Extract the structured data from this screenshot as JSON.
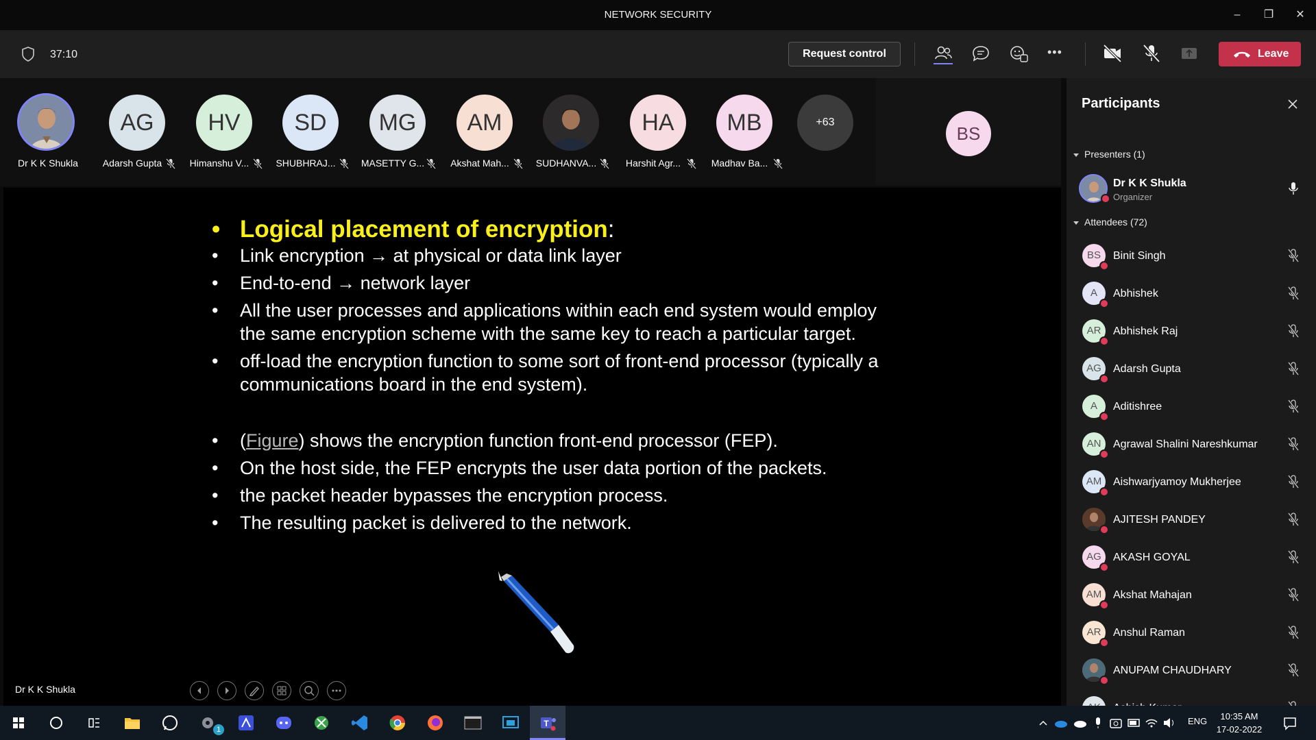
{
  "window": {
    "title": "NETWORK SECURITY",
    "minimize": "–",
    "restore": "❐",
    "close": "✕"
  },
  "toolbar": {
    "timer": "37:10",
    "request_control": "Request control",
    "leave": "Leave",
    "more": "•••"
  },
  "strip": {
    "participants": [
      {
        "initials": "",
        "name": "Dr K K Shukla",
        "color": "#7a8aa8"
      },
      {
        "initials": "AG",
        "name": "Adarsh Gupta",
        "color": "#d9e3ea"
      },
      {
        "initials": "HV",
        "name": "Himanshu V...",
        "color": "#d6efdb"
      },
      {
        "initials": "SD",
        "name": "SHUBHRAJ...",
        "color": "#dbe6f6"
      },
      {
        "initials": "MG",
        "name": "MASETTY G...",
        "color": "#dfe5ea"
      },
      {
        "initials": "AM",
        "name": "Akshat Mah...",
        "color": "#f8dfd4"
      },
      {
        "initials": "",
        "name": "SUDHANVA...",
        "color": "#3a3330"
      },
      {
        "initials": "HA",
        "name": "Harshit Agr...",
        "color": "#f7dde1"
      },
      {
        "initials": "MB",
        "name": "Madhav Ba...",
        "color": "#f6d9ec"
      }
    ],
    "overflow": "+63",
    "bs_initials": "BS"
  },
  "slide": {
    "heading": "Logical placement of encryption",
    "heading_colon": ":",
    "bullet_char": "•",
    "bullets_a": [
      "Link encryption → at physical or data link layer",
      "End-to-end → network layer",
      "All the user processes and applications within each end system would employ the same encryption scheme with the same key to reach a particular target.",
      "off-load the encryption function to some sort of front-end processor (typically a communications board in the end system)."
    ],
    "fig_open": "(",
    "fig_link": "Figure",
    "fig_rest": ") shows the encryption function front-end processor (FEP).",
    "bullets_b": [
      "On the host side, the FEP encrypts the user data portion of the packets.",
      "the packet header bypasses the encryption process.",
      "The resulting packet is delivered to the network."
    ]
  },
  "stage": {
    "speaker": "Dr K K Shukla"
  },
  "panel": {
    "title": "Participants",
    "presenters_label": "Presenters (1)",
    "presenter": {
      "name": "Dr K K Shukla",
      "role": "Organizer"
    },
    "attendees_label": "Attendees (72)",
    "attendees": [
      {
        "initials": "BS",
        "name": "Binit Singh",
        "color": "#f6d9ec"
      },
      {
        "initials": "A",
        "name": "Abhishek",
        "color": "#e4e4f7"
      },
      {
        "initials": "AR",
        "name": "Abhishek Raj",
        "color": "#d6efdb"
      },
      {
        "initials": "AG",
        "name": "Adarsh Gupta",
        "color": "#d9e3ea"
      },
      {
        "initials": "A",
        "name": "Aditishree",
        "color": "#d6efdb"
      },
      {
        "initials": "AN",
        "name": "Agrawal Shalini Nareshkumar",
        "color": "#d6efdb"
      },
      {
        "initials": "AM",
        "name": "Aishwarjyamoy Mukherjee",
        "color": "#dbe6f6"
      },
      {
        "initials": "",
        "name": "AJITESH PANDEY",
        "color": "#5a3a2a"
      },
      {
        "initials": "AG",
        "name": "AKASH GOYAL",
        "color": "#f6d9ec"
      },
      {
        "initials": "AM",
        "name": "Akshat Mahajan",
        "color": "#f8dfd4"
      },
      {
        "initials": "AR",
        "name": "Anshul Raman",
        "color": "#f8e6d2"
      },
      {
        "initials": "",
        "name": "ANUPAM CHAUDHARY",
        "color": "#4c6a78"
      },
      {
        "initials": "AK",
        "name": "Ashish Kumar",
        "color": "#dfe5ea"
      }
    ]
  },
  "taskbar": {
    "lang": "ENG",
    "time": "10:35 AM",
    "date": "17-02-2022",
    "badge": "1"
  }
}
